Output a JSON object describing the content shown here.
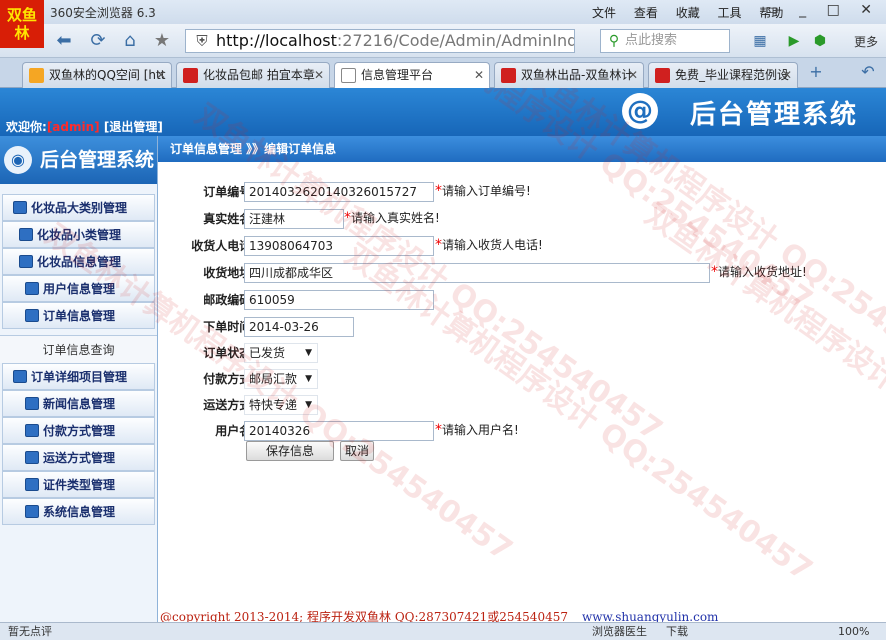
{
  "browser": {
    "title": "360安全浏览器 6.3",
    "logo_text": "双鱼林",
    "menus": [
      "文件",
      "查看",
      "收藏",
      "工具",
      "帮助"
    ],
    "url_host": "http://localhost",
    "url_rest": ":27216/Code/Admin/AdminInde",
    "search_placeholder": "点此搜索",
    "more_label": "更多"
  },
  "tabs": [
    {
      "label": "双鱼林的QQ空间 [htt",
      "color": "#f5a623"
    },
    {
      "label": "化妆品包邮 拍宜本章",
      "color": "#d0201f"
    },
    {
      "label": "信息管理平台",
      "color": "#ffffff"
    },
    {
      "label": "双鱼林出品-双鱼林计",
      "color": "#d0201f"
    },
    {
      "label": "免费_毕业课程范例设",
      "color": "#d0201f"
    }
  ],
  "header": {
    "welcome_prefix": "欢迎你:",
    "user": "[admin]",
    "logout": "[退出管理]",
    "brand": "后台管理系统",
    "brand_icon": "@"
  },
  "sidebar": {
    "title": "后台管理系统",
    "items": [
      "化妆品大类别管理",
      "化妆品小类管理",
      "化妆品信息管理",
      "用户信息管理",
      "订单信息管理"
    ],
    "group_label": "订单信息查询",
    "items2": [
      "订单详细项目管理",
      "新闻信息管理",
      "付款方式管理",
      "运送方式管理",
      "证件类型管理",
      "系统信息管理"
    ]
  },
  "main": {
    "crumb": "订单信息管理  》》编辑订单信息"
  },
  "form": {
    "order_no_label": "订单编号:",
    "order_no": "20140326201403260157​27",
    "order_no_tip": "请输入订单编号!",
    "real_name_label": "真实姓名:",
    "real_name": "汪建林",
    "real_name_tip": "请输入真实姓名!",
    "phone_label": "收货人电话:",
    "phone": "13908064703",
    "phone_tip": "请输入收货人电话!",
    "address_label": "收货地址:",
    "address": "四川成都成华区",
    "address_tip": "请输入收货地址!",
    "postcode_label": "邮政编码:",
    "postcode": "610059",
    "order_time_label": "下单时间:",
    "order_time": "2014-03-26",
    "status_label": "订单状态:",
    "status": "已发货",
    "payment_label": "付款方式:",
    "payment": "邮局汇款",
    "shipping_label": "运送方式:",
    "shipping": "特快专递",
    "username_label": "用户名:",
    "username": "20140326",
    "username_tip": "请输入用户名!",
    "save_label": "保存信息",
    "cancel_label": "取消"
  },
  "footer": {
    "text": "@copyright 2013-2014; 程序开发双鱼林  QQ:287307421或254540457",
    "url": "www.shuangyulin.com"
  },
  "status": {
    "left": "暂无点评",
    "right_items": [
      "浏览器医生",
      "下载",
      "100%"
    ]
  },
  "watermark_text": "双鱼林计算机程序设计 QQ:254540457"
}
